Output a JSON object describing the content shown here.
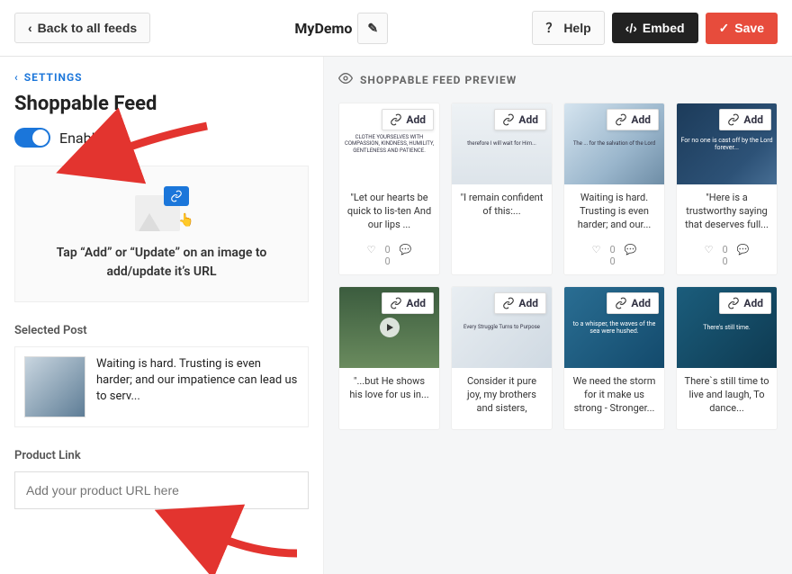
{
  "topbar": {
    "back": "Back to all feeds",
    "feedName": "MyDemo",
    "help": "Help",
    "embed": "Embed",
    "save": "Save"
  },
  "sidebar": {
    "crumb": "SETTINGS",
    "title": "Shoppable Feed",
    "enable": "Enable",
    "instruction": "Tap “Add” or “Update” on an image to add/update it’s URL",
    "selectedLabel": "Selected Post",
    "selectedText": "Waiting is hard. Trusting is even harder; and our impatience can lead us to serv...",
    "productLinkLabel": "Product Link",
    "productPlaceholder": "Add your product URL here"
  },
  "preview": {
    "header": "SHOPPABLE FEED PREVIEW",
    "addLabel": "Add",
    "cards": [
      {
        "caption": "\"Let our hearts be quick to lis-ten\nAnd our lips ...",
        "likes": 0,
        "comments": 0,
        "bg": "bg0",
        "thumbText": "CLOTHE YOURSELVES WITH COMPASSION, KINDNESS, HUMILITY, GENTLENESS AND PATIENCE."
      },
      {
        "caption": "\"I remain confident of this:...",
        "likes": null,
        "comments": null,
        "bg": "bg1",
        "thumbText": "therefore I will wait for Him..."
      },
      {
        "caption": "Waiting is hard. Trusting is even harder; and our...",
        "likes": 0,
        "comments": 0,
        "bg": "bg2",
        "thumbText": "The ... for the salvation of the Lord"
      },
      {
        "caption": "\"Here is a trustworthy saying that deserves full...",
        "likes": 0,
        "comments": 0,
        "bg": "bg3",
        "thumbText": "For no one is cast off by the Lord forever..."
      },
      {
        "caption": "\"...but He shows his love for us in...",
        "likes": null,
        "comments": null,
        "bg": "bg4",
        "thumbText": "",
        "hasPlay": true
      },
      {
        "caption": "Consider it pure joy, my brothers and sisters,",
        "likes": null,
        "comments": null,
        "bg": "bg5",
        "thumbText": "Every Struggle Turns to Purpose"
      },
      {
        "caption": "We need the storm for it make us strong - Stronger...",
        "likes": null,
        "comments": null,
        "bg": "bg6",
        "thumbText": "to a whisper, the waves of the sea were hushed."
      },
      {
        "caption": "There`s still time to live and laugh, To dance...",
        "likes": null,
        "comments": null,
        "bg": "bg7",
        "thumbText": "There's still time."
      }
    ]
  }
}
